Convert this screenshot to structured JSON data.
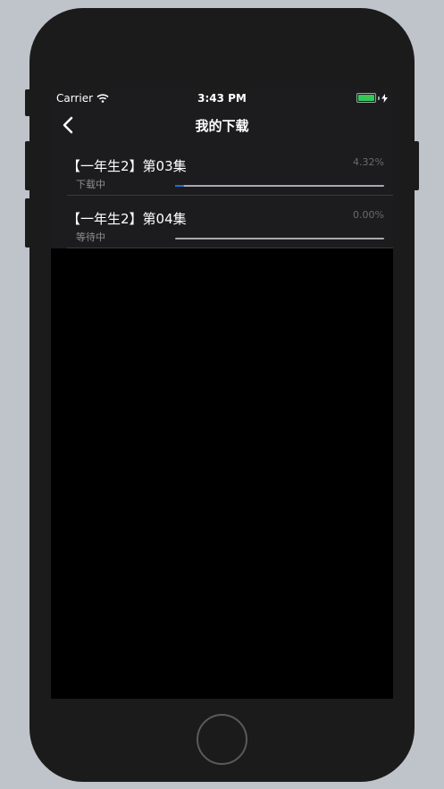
{
  "status_bar": {
    "carrier": "Carrier",
    "time": "3:43 PM",
    "battery_color": "#35c759"
  },
  "nav": {
    "title": "我的下载",
    "back_icon": "chevron-left-icon"
  },
  "downloads": [
    {
      "name": "【一年生2】第03集",
      "status": "下载中",
      "percent": "4.32%",
      "progress": 0.0432
    },
    {
      "name": "【一年生2】第04集",
      "status": "等待中",
      "percent": "0.00%",
      "progress": 0.0
    }
  ],
  "colors": {
    "progress_fill": "#1f6fd6",
    "progress_track": "#a8a8ad",
    "background": "#000000",
    "cell": "#1c1c1e"
  }
}
